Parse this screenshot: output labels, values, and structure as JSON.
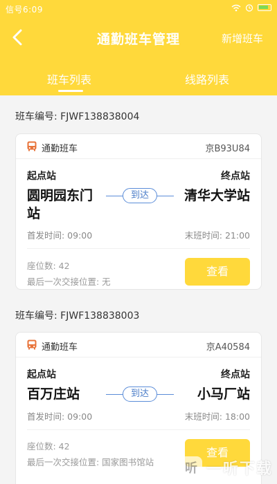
{
  "status_bar": {
    "carrier": "信号6:09"
  },
  "nav": {
    "title": "通勤班车管理",
    "add_label": "新增班车"
  },
  "tabs": [
    {
      "label": "班车列表"
    },
    {
      "label": "线路列表"
    }
  ],
  "colors": {
    "brand": "#ffd93b",
    "accent_blue": "#5a8cd8",
    "bus_icon": "#e8743b"
  },
  "buses": [
    {
      "number_label": "班车编号: FJWF138838004",
      "type": "通勤班车",
      "plate": "京B93U84",
      "start_label": "起点站",
      "end_label": "终点站",
      "start_station_line1": "圆明园东门",
      "start_station_line2": "站",
      "end_station": "清华大学站",
      "arrive_label": "到达",
      "first_departure": "首发时间: 09:00",
      "last_bus": "末班时间: 21:00",
      "seats": "座位数: 42",
      "last_handover": "最后一次交接位置: 无",
      "view_label": "查看"
    },
    {
      "number_label": "班车编号: FJWF138838003",
      "type": "通勤班车",
      "plate": "京A40584",
      "start_label": "起点站",
      "end_label": "终点站",
      "start_station": "百万庄站",
      "end_station": "小马厂站",
      "arrive_label": "到达",
      "first_departure": "首发时间: 09:00",
      "last_bus": "末班时间: 18:00",
      "seats": "座位数: 42",
      "last_handover": "最后一次交接位置: 国家图书馆站",
      "view_label": "查看"
    }
  ],
  "watermark": {
    "text": "一听下载",
    "icon_text": "听"
  }
}
